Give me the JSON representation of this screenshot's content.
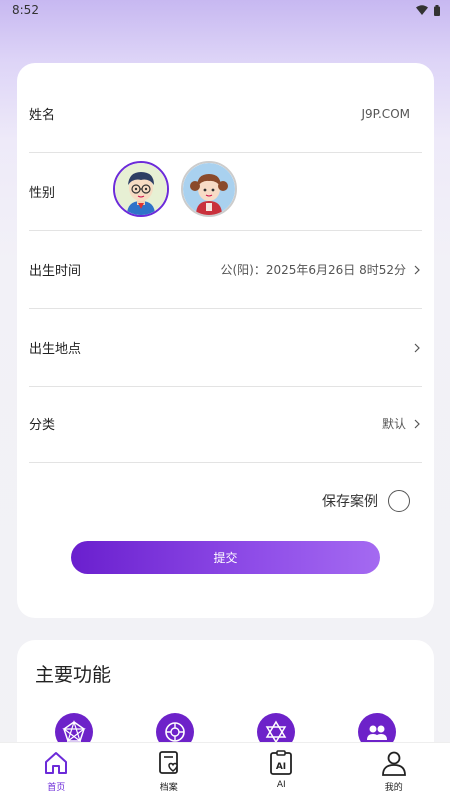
{
  "status_bar": {
    "time": "8:52"
  },
  "form": {
    "name": {
      "label": "姓名",
      "value": "J9P.COM"
    },
    "gender": {
      "label": "性别",
      "options": [
        {
          "name": "male",
          "selected": true
        },
        {
          "name": "female",
          "selected": false
        }
      ]
    },
    "birth_time": {
      "label": "出生时间",
      "value": "公(阳)：2025年6月26日 8时52分"
    },
    "birth_place": {
      "label": "出生地点",
      "value": ""
    },
    "category": {
      "label": "分类",
      "value": "默认"
    },
    "save_case": {
      "label": "保存案例",
      "checked": false
    },
    "submit_label": "提交"
  },
  "features": {
    "title": "主要功能",
    "icons": [
      "pentagram-chart-icon",
      "wheel-icon",
      "hexagram-star-icon",
      "people-icon"
    ]
  },
  "bottom_nav": {
    "items": [
      {
        "label": "首页",
        "icon": "home-icon",
        "active": true
      },
      {
        "label": "档案",
        "icon": "archive-heart-icon",
        "active": false
      },
      {
        "label": "AI",
        "icon": "ai-icon",
        "active": false
      },
      {
        "label": "我的",
        "icon": "profile-icon",
        "active": false
      }
    ]
  },
  "colors": {
    "accent": "#6c2bd9",
    "button_start": "#6a1fce",
    "button_end": "#a46af1"
  }
}
